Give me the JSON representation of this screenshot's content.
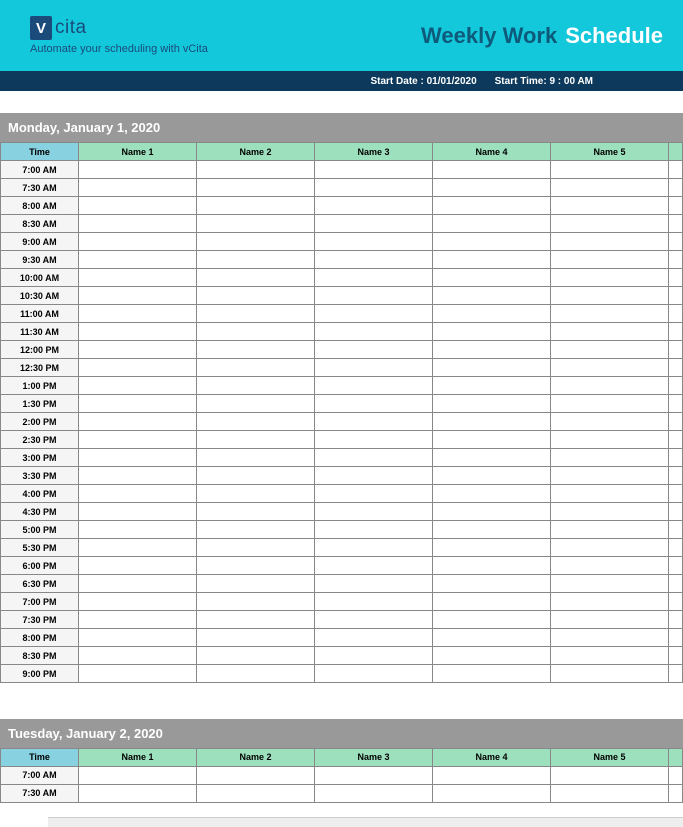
{
  "header": {
    "logo_v": "V",
    "logo_text": "cita",
    "tagline": "Automate your scheduling with vCita",
    "title_part1": "Weekly Work",
    "title_part2": "Schedule",
    "start_date_label": "Start Date : 01/01/2020",
    "start_time_label": "Start Time:  9 : 00 AM"
  },
  "columns": {
    "time": "Time",
    "name1": "Name 1",
    "name2": "Name 2",
    "name3": "Name 3",
    "name4": "Name 4",
    "name5": "Name 5"
  },
  "days": {
    "mon": {
      "label": "Monday, January 1, 2020"
    },
    "tue": {
      "label": "Tuesday, January 2, 2020"
    }
  },
  "times_full": [
    "7:00 AM",
    "7:30 AM",
    "8:00 AM",
    "8:30 AM",
    "9:00 AM",
    "9:30 AM",
    "10:00 AM",
    "10:30 AM",
    "11:00 AM",
    "11:30 AM",
    "12:00 PM",
    "12:30 PM",
    "1:00 PM",
    "1:30 PM",
    "2:00 PM",
    "2:30 PM",
    "3:00 PM",
    "3:30 PM",
    "4:00 PM",
    "4:30 PM",
    "5:00 PM",
    "5:30 PM",
    "6:00 PM",
    "6:30 PM",
    "7:00 PM",
    "7:30 PM",
    "8:00 PM",
    "8:30 PM",
    "9:00 PM"
  ],
  "times_short": [
    "7:00 AM",
    "7:30 AM"
  ]
}
